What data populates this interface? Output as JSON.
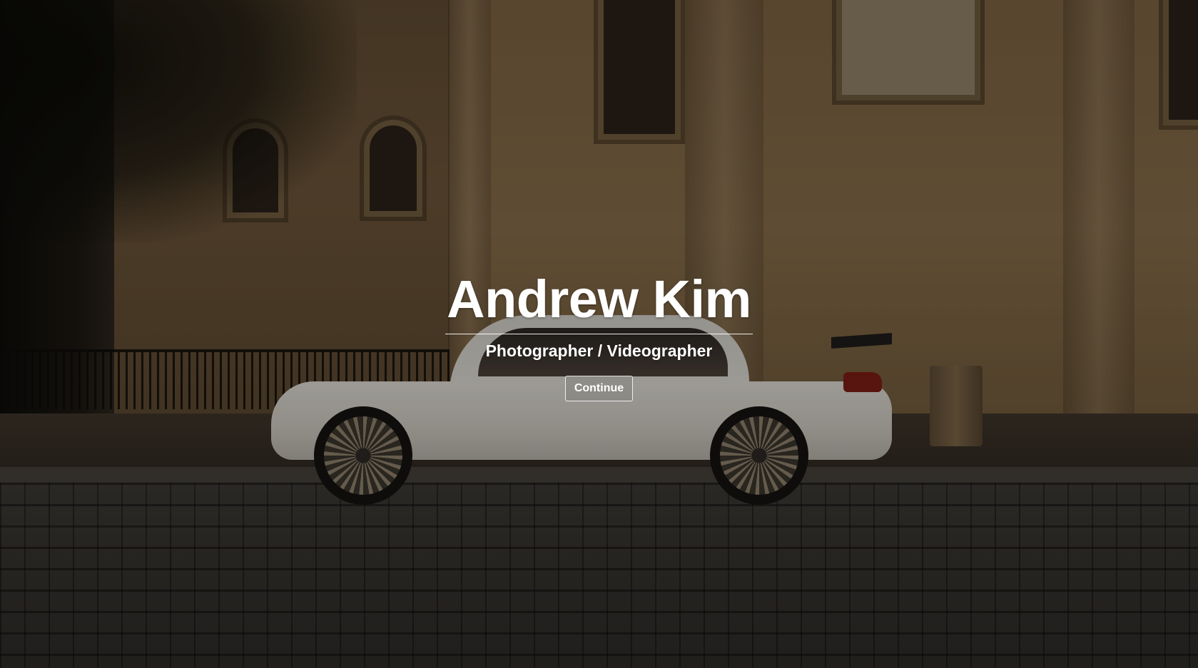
{
  "hero": {
    "name": "Andrew Kim",
    "subtitle": "Photographer / Videographer",
    "continue_label": "Continue"
  },
  "colors": {
    "text": "#ffffff",
    "overlay": "rgba(0,0,0,0.28)"
  }
}
